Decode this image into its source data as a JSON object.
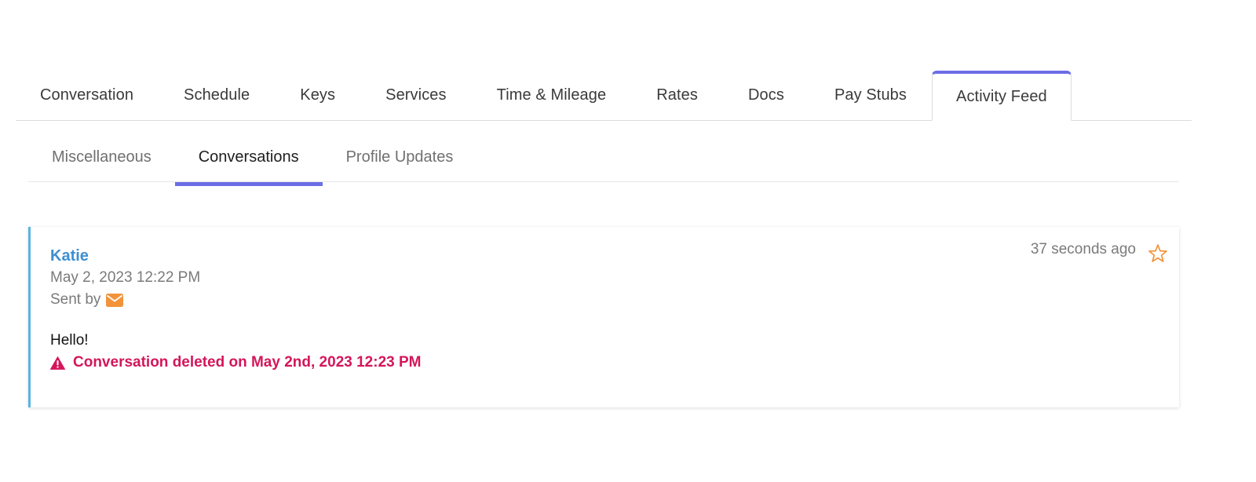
{
  "main_tabs": [
    {
      "label": "Conversation"
    },
    {
      "label": "Schedule"
    },
    {
      "label": "Keys"
    },
    {
      "label": "Services"
    },
    {
      "label": "Time & Mileage"
    },
    {
      "label": "Rates"
    },
    {
      "label": "Docs"
    },
    {
      "label": "Pay Stubs"
    },
    {
      "label": "Activity Feed"
    }
  ],
  "sub_tabs": [
    {
      "label": "Miscellaneous"
    },
    {
      "label": "Conversations"
    },
    {
      "label": "Profile Updates"
    }
  ],
  "feed_item": {
    "author": "Katie",
    "date": "May 2, 2023 12:22 PM",
    "sent_by_label": "Sent by",
    "sent_by_icon": "envelope-icon",
    "message": "Hello!",
    "deleted_note": "Conversation deleted on May 2nd, 2023 12:23 PM",
    "deleted_icon": "warning-triangle-icon",
    "time_ago": "37 seconds ago",
    "star_icon": "star-outline-icon"
  },
  "colors": {
    "accent": "#6c6ee6",
    "author_link": "#3d8fd1",
    "card_border": "#5ab4e0",
    "warning": "#d4165a",
    "envelope": "#f2933a",
    "star": "#f2933a"
  }
}
